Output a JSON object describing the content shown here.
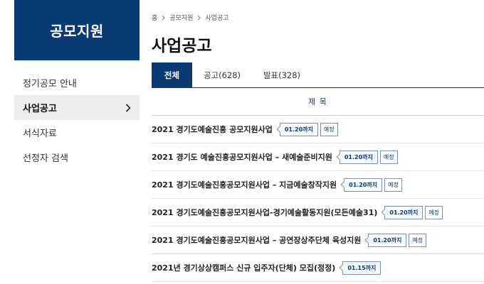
{
  "sidebar": {
    "title": "공모지원",
    "items": [
      {
        "label": "정기공모 안내"
      },
      {
        "label": "사업공고"
      },
      {
        "label": "서식자료"
      },
      {
        "label": "선정자 검색"
      }
    ]
  },
  "breadcrumb": [
    "홈",
    "공모지원",
    "사업공고"
  ],
  "page": {
    "title": "사업공고"
  },
  "tabs": [
    {
      "label": "전체"
    },
    {
      "label": "공고(628)"
    },
    {
      "label": "발표(328)"
    }
  ],
  "table": {
    "column_header": "제 목",
    "rows": [
      {
        "title": "2021 경기도예술진흥 공모지원사업",
        "deadline": "01.20까지",
        "status": "예정"
      },
      {
        "title": "2021 경기도 예술진흥공모지원사업 – 새예술준비지원",
        "deadline": "01.20까지",
        "status": "예정"
      },
      {
        "title": "2021 경기도예술진흥공모지원사업 – 지금예술창작지원",
        "deadline": "01.20까지",
        "status": "예정"
      },
      {
        "title": "2021 경기도예술진흥공모지원사업-경기예술활동지원(모든예술31)",
        "deadline": "01.20까지",
        "status": "예정"
      },
      {
        "title": "2021 경기도예술진흥공모지원사업 – 공연장상주단체 육성지원",
        "deadline": "01.20까지",
        "status": "예정"
      },
      {
        "title": "2021년 경기상상캠퍼스 신규 입주자(단체) 모집(정정)",
        "deadline": "01.15까지",
        "status": ""
      }
    ]
  },
  "colors": {
    "primary": "#0a3a73",
    "active_bg": "#ededed"
  },
  "icons": {
    "breadcrumb_separator": "chevron-right-icon",
    "active_item": "chevron-right-icon"
  }
}
